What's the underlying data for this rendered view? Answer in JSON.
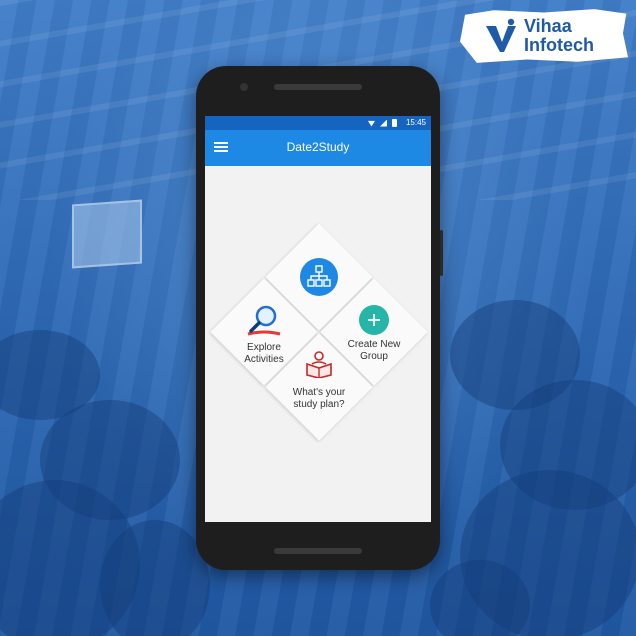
{
  "branding": {
    "line1": "Vihaa",
    "line2": "Infotech"
  },
  "status": {
    "time": "15:45"
  },
  "app": {
    "title": "Date2Study"
  },
  "tiles": {
    "explore": {
      "line1": "Explore",
      "line2": "Activities"
    },
    "create": {
      "line1": "Create New",
      "line2": "Group"
    },
    "plan": {
      "line1": "What's your",
      "line2": "study plan?"
    }
  },
  "colors": {
    "appbar": "#1e88e5",
    "statusbar": "#1565c0",
    "group_icon": "#1e88e5",
    "create_icon": "#26b5a6",
    "plan_icon": "#c62828"
  }
}
